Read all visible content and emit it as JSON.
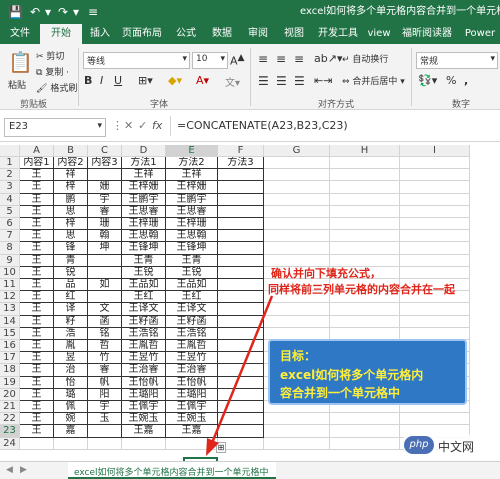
{
  "titlebar": {
    "title": "excel如何将多个单元格内容合并到一个单元格中"
  },
  "tabs": [
    "文件",
    "开始",
    "插入",
    "页面布局",
    "公式",
    "数据",
    "审阅",
    "视图",
    "开发工具",
    "view",
    "福昕阅读器",
    "Power"
  ],
  "ribbon": {
    "paste": "粘贴",
    "cut": "剪切",
    "copy": "复制 ·",
    "format_painter": "格式刷",
    "group_clipboard": "剪贴板",
    "font_name": "等线",
    "font_size": "10",
    "bold": "B",
    "italic": "I",
    "underline": "U",
    "font_color_glyph": "A",
    "group_font": "字体",
    "wrap_text": "自动换行",
    "merge_center": "合并后居中",
    "group_align": "对齐方式",
    "number_format": "常规",
    "percent": "%",
    "comma": ",",
    "group_number": "数字"
  },
  "formula_bar": {
    "name_box": "E23",
    "fx": "fx",
    "formula": "=CONCATENATE(A23,B23,C23)"
  },
  "columns": [
    "A",
    "B",
    "C",
    "D",
    "E",
    "F",
    "G",
    "H",
    "I"
  ],
  "rows": [
    [
      "内容1",
      "内容2",
      "内容3",
      "方法1",
      "方法2",
      "方法3"
    ],
    [
      "王",
      "祥",
      "",
      "王祥",
      "王祥",
      ""
    ],
    [
      "王",
      "梓",
      "姗",
      "王梓姗",
      "王梓姗",
      ""
    ],
    [
      "王",
      "鹏",
      "宇",
      "王鹏宇",
      "王鹏宇",
      ""
    ],
    [
      "王",
      "思",
      "睿",
      "王思睿",
      "王思睿",
      ""
    ],
    [
      "王",
      "梓",
      "珊",
      "王梓珊",
      "王梓珊",
      ""
    ],
    [
      "王",
      "思",
      "翰",
      "王思翰",
      "王思翰",
      ""
    ],
    [
      "王",
      "锋",
      "坤",
      "王锋坤",
      "王锋坤",
      ""
    ],
    [
      "王",
      "青",
      "",
      "王青",
      "王青",
      ""
    ],
    [
      "王",
      "锐",
      "",
      "王锐",
      "王锐",
      ""
    ],
    [
      "王",
      "品",
      "如",
      "王品如",
      "王品如",
      ""
    ],
    [
      "王",
      "红",
      "",
      "王红",
      "王红",
      ""
    ],
    [
      "王",
      "译",
      "文",
      "王译文",
      "王译文",
      ""
    ],
    [
      "王",
      "籽",
      "菡",
      "王籽菡",
      "王籽菡",
      ""
    ],
    [
      "王",
      "浩",
      "铭",
      "王浩铭",
      "王浩铭",
      ""
    ],
    [
      "王",
      "胤",
      "哲",
      "王胤哲",
      "王胤哲",
      ""
    ],
    [
      "王",
      "昱",
      "竹",
      "王昱竹",
      "王昱竹",
      ""
    ],
    [
      "王",
      "治",
      "睿",
      "王治睿",
      "王治睿",
      ""
    ],
    [
      "王",
      "怡",
      "帆",
      "王怡帆",
      "王怡帆",
      ""
    ],
    [
      "王",
      "璐",
      "阳",
      "王璐阳",
      "王璐阳",
      ""
    ],
    [
      "王",
      "佩",
      "宇",
      "王佩宇",
      "王佩宇",
      ""
    ],
    [
      "王",
      "婉",
      "玉",
      "王婉玉",
      "王婉玉",
      ""
    ],
    [
      "王",
      "嘉",
      "",
      "王嘉",
      "王嘉",
      ""
    ],
    [
      "",
      "",
      "",
      "",
      "",
      ""
    ]
  ],
  "annotation_red": [
    "确认并向下填充公式，",
    "同样将前三列单元格的内容合并在一起"
  ],
  "annotation_blue": [
    "目标：",
    "excel如何将多个单元格内",
    "容合并到一个单元格中"
  ],
  "sheet_tab": "excel如何将多个单元格内容合并到一个单元格中",
  "watermark": "php 中文网",
  "colors": {
    "excel_green": "#217346",
    "annot_red": "#e0261b",
    "annot_blue": "#2e78c5",
    "annot_yellow": "#ffef3a"
  }
}
